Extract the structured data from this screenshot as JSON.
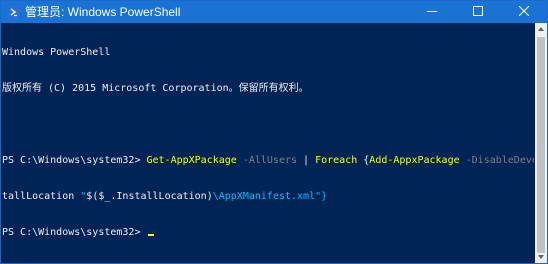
{
  "window": {
    "title": "管理员: Windows PowerShell",
    "accent_color": "#1a73d4",
    "console_bg": "#012456",
    "icons": {
      "app": "powershell-icon",
      "minimize": "minimize-icon",
      "maximize": "maximize-icon",
      "close": "close-icon"
    }
  },
  "console": {
    "header_line1": "Windows PowerShell",
    "header_line2": "版权所有 (C) 2015 Microsoft Corporation。保留所有权利。",
    "command_line": {
      "prompt": "PS C:\\Windows\\system32> ",
      "cmd1": "Get-AppXPackage",
      "param1": " -AllUsers",
      "pipe": " | ",
      "cmd2": "Foreach",
      "brace": " {",
      "cmd3": "Add-AppxPackage",
      "param2": " -DisableDevelop",
      "wrap_text": "tallLocation",
      "quote_open": " \"",
      "var": "$($_.InstallLocation)",
      "path": "\\AppXManifest.xml",
      "quote_close": "\"}"
    },
    "prompt2": "PS C:\\Windows\\system32> ",
    "colors": {
      "command": "#ffff00",
      "parameter": "#808080",
      "string": "#00bfff",
      "text": "#eeedf0"
    }
  }
}
